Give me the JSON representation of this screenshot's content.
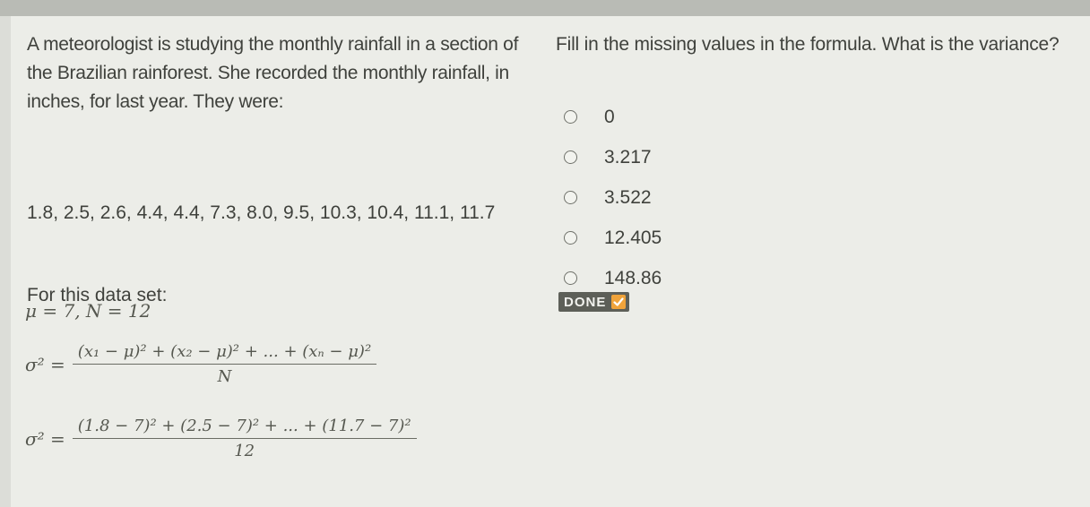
{
  "passage": {
    "intro": "A meteorologist is studying the monthly rainfall in a section of the Brazilian rainforest. She recorded the monthly rainfall, in inches, for last year. They were:",
    "values": "1.8, 2.5, 2.6, 4.4, 4.4, 7.3, 8.0, 9.5, 10.3, 10.4, 11.1, 11.7",
    "dataset_label": "For this data set:",
    "params": "μ = 7, N = 12",
    "formula1": {
      "lhs": "σ² =",
      "numerator": "(x₁ − μ)² + (x₂ − μ)² + ... + (xₙ − μ)²",
      "denominator": "N"
    },
    "formula2": {
      "lhs": "σ² =",
      "numerator": "(1.8 − 7)² + (2.5 − 7)² + ... + (11.7 − 7)²",
      "denominator": "12"
    }
  },
  "question": {
    "prompt": "Fill in the missing values in the formula. What is the variance?",
    "options": [
      "0",
      "3.217",
      "3.522",
      "12.405",
      "148.86"
    ],
    "done_label": "DONE"
  },
  "colors": {
    "done_check": "#f0a33a",
    "done_bg": "#5d5f58"
  }
}
